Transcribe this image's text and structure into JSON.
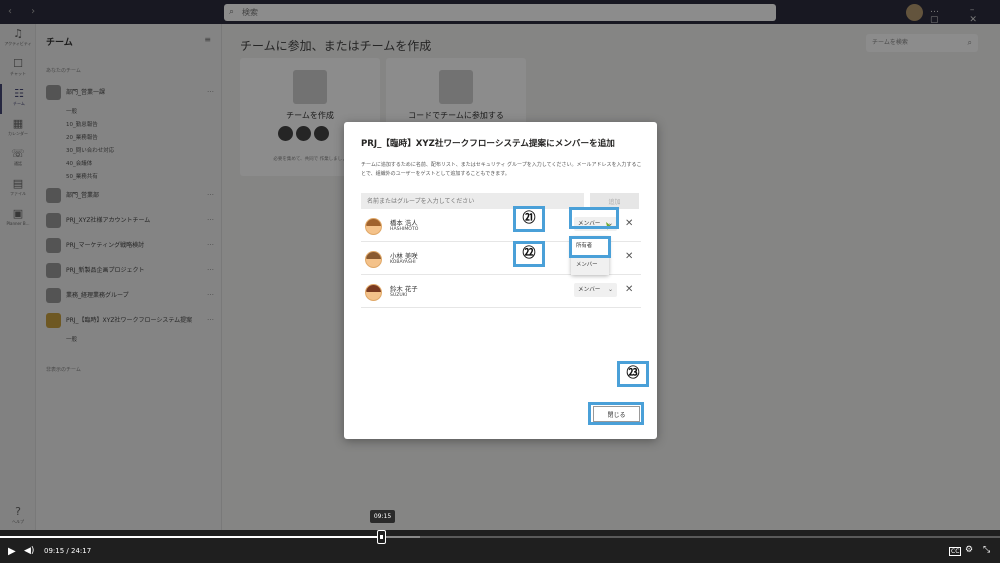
{
  "titlebar": {
    "search_placeholder": "検索"
  },
  "rail": {
    "items": [
      {
        "label": "アクティビティ",
        "icon": "bell-icon"
      },
      {
        "label": "チャット",
        "icon": "chat-icon"
      },
      {
        "label": "チーム",
        "icon": "teams-icon"
      },
      {
        "label": "カレンダー",
        "icon": "calendar-icon"
      },
      {
        "label": "通話",
        "icon": "phone-icon"
      },
      {
        "label": "ファイル",
        "icon": "file-icon"
      },
      {
        "label": "Planner B...",
        "icon": "planner-icon"
      }
    ],
    "bottom_label": "ヘルプ"
  },
  "teams_pane": {
    "title": "チーム",
    "your_teams_label": "あなたのチーム",
    "hidden_teams_label": "非表示のチーム",
    "teams": [
      {
        "name": "部門_営業一課",
        "channels": [
          "一般",
          "10_勤怠報告",
          "20_業務報告",
          "30_問い合わせ対応",
          "40_会議体",
          "50_業務共有"
        ]
      },
      {
        "name": "部門_営業部",
        "channels": []
      },
      {
        "name": "PRJ_XYZ社様アカウントチーム",
        "channels": []
      },
      {
        "name": "PRJ_マーケティング戦略検討",
        "channels": []
      },
      {
        "name": "PRJ_新製品企画プロジェクト",
        "channels": []
      },
      {
        "name": "業務_経理業務グループ",
        "channels": []
      },
      {
        "name": "PRJ_【臨時】XYZ社ワークフローシステム提案",
        "channels": [
          "一般"
        ]
      }
    ]
  },
  "main": {
    "title": "チームに参加、またはチームを作成",
    "search_placeholder": "チームを検索",
    "cards": [
      {
        "title": "チームを作成",
        "subtitle": "必要を集めて、共同で 作業しましょ"
      },
      {
        "title": "コードでチームに参加する",
        "subtitle": ""
      }
    ]
  },
  "dialog": {
    "title": "PRJ_【臨時】XYZ社ワークフローシステム提案にメンバーを追加",
    "description": "チームに追加するために名前、配布リスト、またはセキュリティ グループを入力してください。メールアドレスを入力することで、組織外のユーザーをゲストとして追加することもできます。",
    "name_input_placeholder": "名前またはグループを入力してください",
    "add_button": "追加",
    "members": [
      {
        "name": "橋本 浩人",
        "id": "HASHIMOTO",
        "role": "メンバー"
      },
      {
        "name": "小林 美咲",
        "id": "KOBAYASHI",
        "role": "メンバー"
      },
      {
        "name": "鈴木 花子",
        "id": "SUZUKI",
        "role": "メンバー"
      }
    ],
    "role_options": [
      "所有者",
      "メンバー"
    ],
    "close_button": "閉じる"
  },
  "callouts": [
    "㉑",
    "㉒",
    "㉓"
  ],
  "player": {
    "current_time": "09:15",
    "total_time": "24:17",
    "separator": "/",
    "tooltip_time": "09:15",
    "progress_fraction": 0.38,
    "cc_label": "CC"
  },
  "colors": {
    "callout_border": "#4aa0d8",
    "teams_purple": "#464775"
  }
}
